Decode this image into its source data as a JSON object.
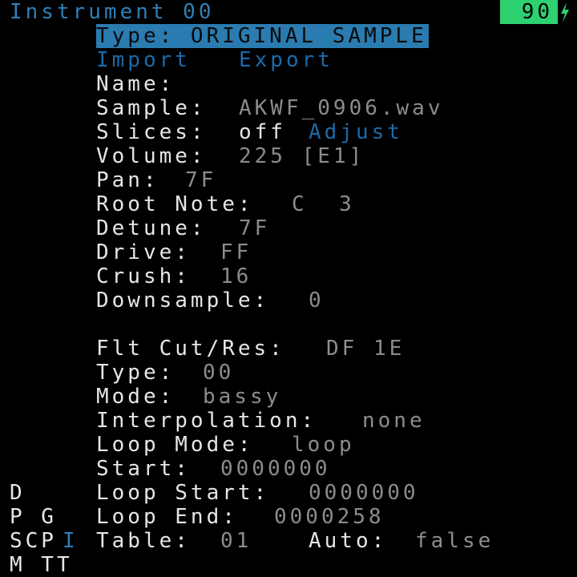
{
  "header": {
    "title": "Instrument 00",
    "battery": "90"
  },
  "menu": {
    "type_item": "Type: ORIGINAL SAMPLE",
    "import": "Import",
    "export": "Export"
  },
  "fields": {
    "name_label": "Name:",
    "sample_label": "Sample:",
    "sample_value": "AKWF_0906.wav",
    "slices_label": "Slices:",
    "slices_value": "off",
    "slices_action": "Adjust",
    "volume_label": "Volume:",
    "volume_value": "225 [E1]",
    "pan_label": "Pan:",
    "pan_value": "7F",
    "root_label": "Root Note:",
    "root_value": "C  3",
    "detune_label": "Detune:",
    "detune_value": "7F",
    "drive_label": "Drive:",
    "drive_value": "FF",
    "crush_label": "Crush:",
    "crush_value": "16",
    "downsample_label": "Downsample:",
    "downsample_value": "0",
    "flt_label": "Flt Cut/Res:",
    "flt_value": "DF 1E",
    "ftype_label": "Type:",
    "ftype_value": "00",
    "mode_label": "Mode:",
    "mode_value": "bassy",
    "interp_label": "Interpolation:",
    "interp_value": "none",
    "loopmode_label": "Loop Mode:",
    "loopmode_value": "loop",
    "start_label": "Start:",
    "start_value": "0000000",
    "loopstart_label": "Loop Start:",
    "loopstart_value": "0000000",
    "loopend_label": "Loop End:",
    "loopend_value": "0000258",
    "table_label": "Table:",
    "table_value": "01",
    "auto_label": "Auto:",
    "auto_value": "false"
  },
  "sidebar": {
    "row1": "D",
    "row2": "P G",
    "row3a": "SCP",
    "row3b": "I",
    "row4": "M TT"
  },
  "colors": {
    "background": "#000000",
    "label": "#e6e6e6",
    "value": "#8c8c8c",
    "action": "#1c6aa8",
    "selection": "#2a7bb0",
    "battery": "#2ed16f"
  }
}
